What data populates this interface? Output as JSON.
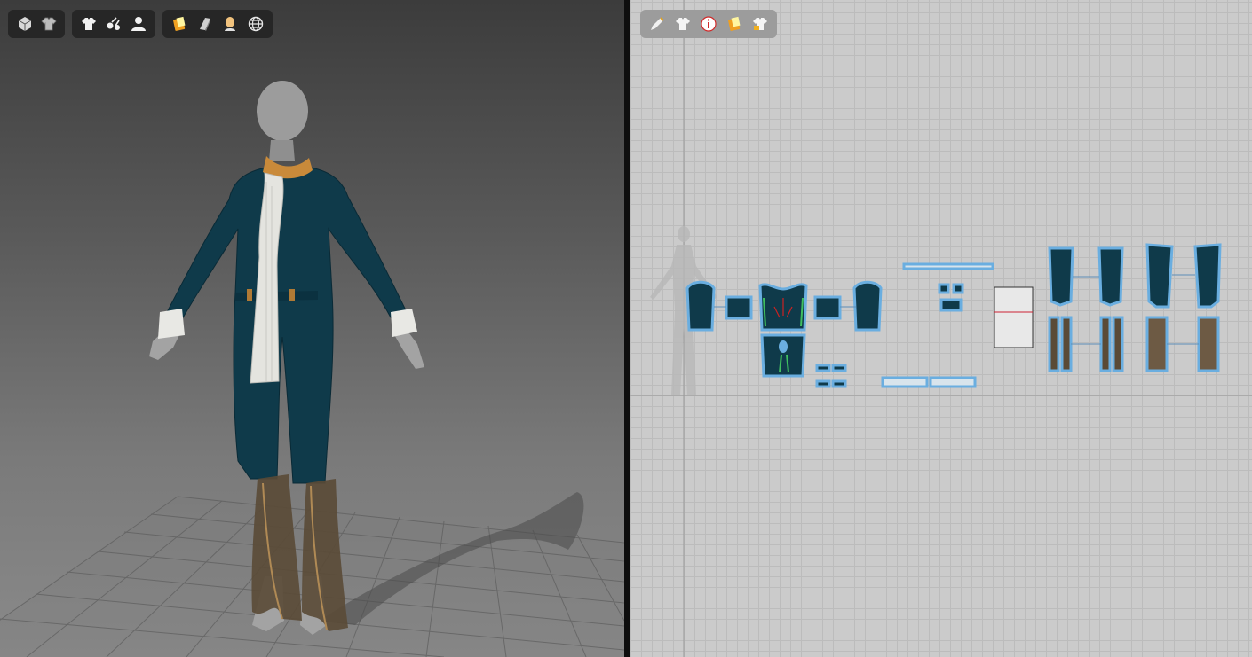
{
  "viewport_3d": {
    "toolbar_group_1": [
      {
        "icon": "box-solid-icon"
      },
      {
        "icon": "garment-texture-icon"
      }
    ],
    "toolbar_group_2": [
      {
        "icon": "shirt-icon"
      },
      {
        "icon": "pins-icon"
      },
      {
        "icon": "avatar-icon"
      }
    ],
    "toolbar_group_3": [
      {
        "icon": "fabric-color-icon"
      },
      {
        "icon": "layer-icon"
      },
      {
        "icon": "avatar-skin-icon"
      },
      {
        "icon": "globe-icon"
      }
    ],
    "colors": {
      "garment": "#0f3a4a",
      "scarf": "#e8e8e4",
      "avatar": "#9a9a9a",
      "accent": "#c98a3a"
    }
  },
  "viewport_2d": {
    "toolbar": [
      {
        "icon": "pencil-icon"
      },
      {
        "icon": "shirt-icon"
      },
      {
        "icon": "info-icon"
      },
      {
        "icon": "fabric-color-icon"
      },
      {
        "icon": "lock-shirt-icon"
      }
    ],
    "colors": {
      "pattern_fill": "#0f3a4a",
      "pattern_outline": "#6aaee0",
      "grid": "#cbcbcb"
    }
  }
}
